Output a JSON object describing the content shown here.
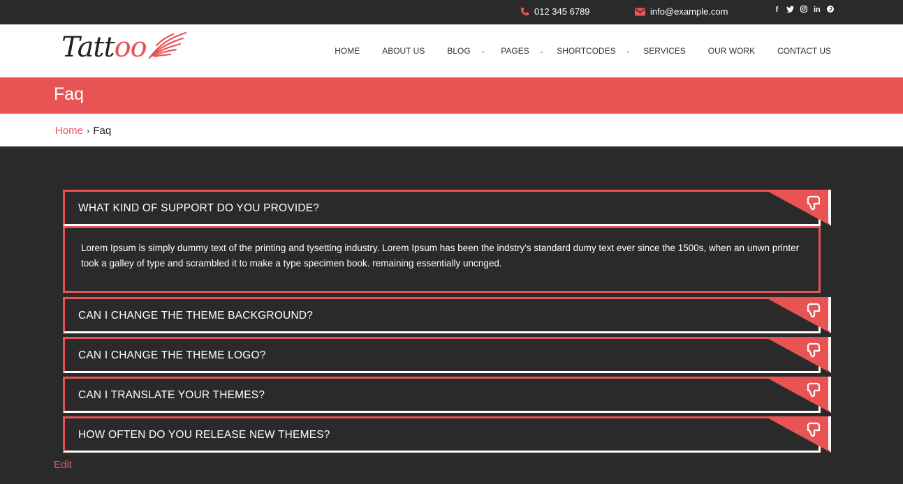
{
  "topbar": {
    "phone": "012 345 6789",
    "email": "info@example.com",
    "social": [
      "facebook-icon",
      "twitter-icon",
      "instagram-icon",
      "linkedin-icon",
      "pinterest-icon"
    ]
  },
  "header": {
    "logo_main": "Tattoo",
    "nav": [
      {
        "label": "HOME",
        "dropdown": false
      },
      {
        "label": "ABOUT US",
        "dropdown": false
      },
      {
        "label": "BLOG",
        "dropdown": true
      },
      {
        "label": "PAGES",
        "dropdown": true
      },
      {
        "label": "SHORTCODES",
        "dropdown": true
      },
      {
        "label": "SERVICES",
        "dropdown": false
      },
      {
        "label": "OUR WORK",
        "dropdown": false
      },
      {
        "label": "CONTACT US",
        "dropdown": false
      }
    ]
  },
  "page": {
    "title": "Faq",
    "breadcrumb_home": "Home",
    "breadcrumb_current": "Faq"
  },
  "faq": [
    {
      "question": "WHAT KIND OF SUPPORT DO YOU PROVIDE?",
      "open": true,
      "answer": "Lorem Ipsum is simply dummy text of the printing and tysetting industry. Lorem Ipsum has been the indstry's standard dumy text ever since the 1500s, when an unwn printer took a galley of type and scrambled it to make a type specimen book. remaining essentially uncnged."
    },
    {
      "question": "CAN I CHANGE THE THEME BACKGROUND?",
      "open": false
    },
    {
      "question": "CAN I CHANGE THE THEME LOGO?",
      "open": false
    },
    {
      "question": "CAN I TRANSLATE YOUR THEMES?",
      "open": false
    },
    {
      "question": "HOW OFTEN DO YOU RELEASE NEW THEMES?",
      "open": false
    }
  ],
  "footer": {
    "edit_label": "Edit"
  },
  "colors": {
    "accent": "#e85454",
    "dark": "#2b2a2a"
  }
}
